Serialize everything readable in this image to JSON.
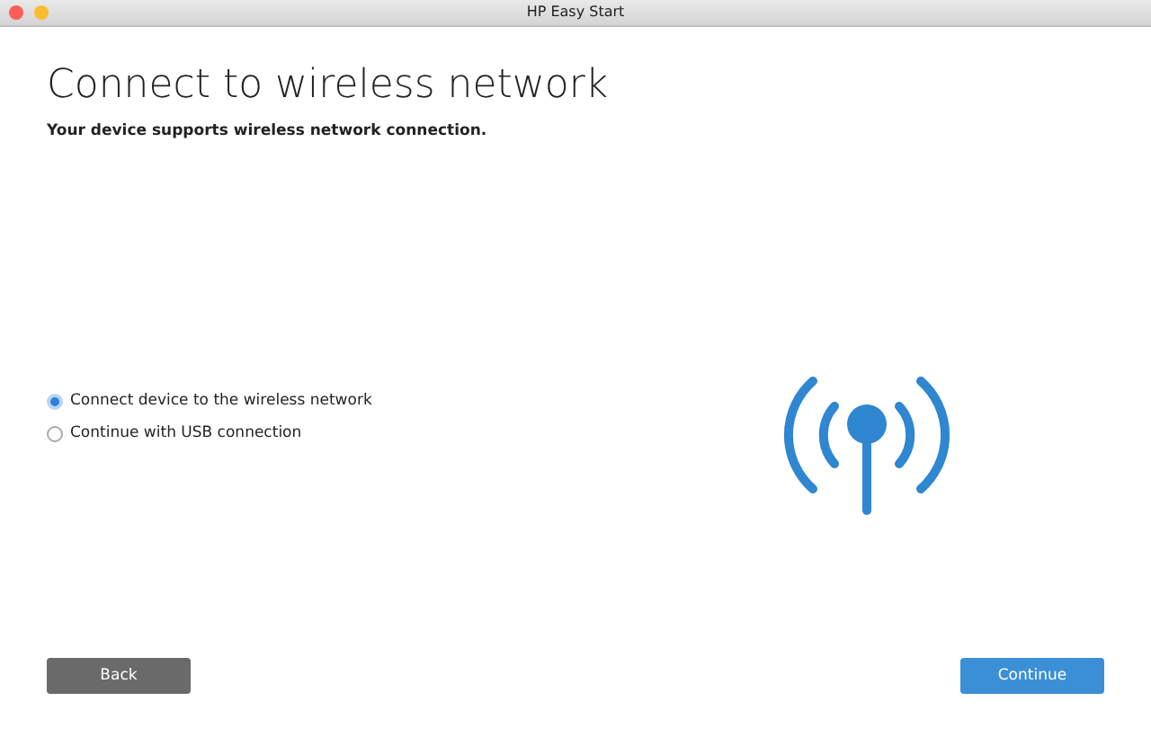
{
  "window": {
    "title": "HP Easy Start"
  },
  "heading": "Connect to wireless network",
  "subtitle": "Your device supports wireless network connection.",
  "options": [
    {
      "label": "Connect device to the wireless network",
      "selected": true
    },
    {
      "label": "Continue with USB connection",
      "selected": false
    }
  ],
  "buttons": [
    {
      "label": "Back",
      "kind": "secondary"
    },
    {
      "label": "Continue",
      "kind": "primary"
    }
  ]
}
